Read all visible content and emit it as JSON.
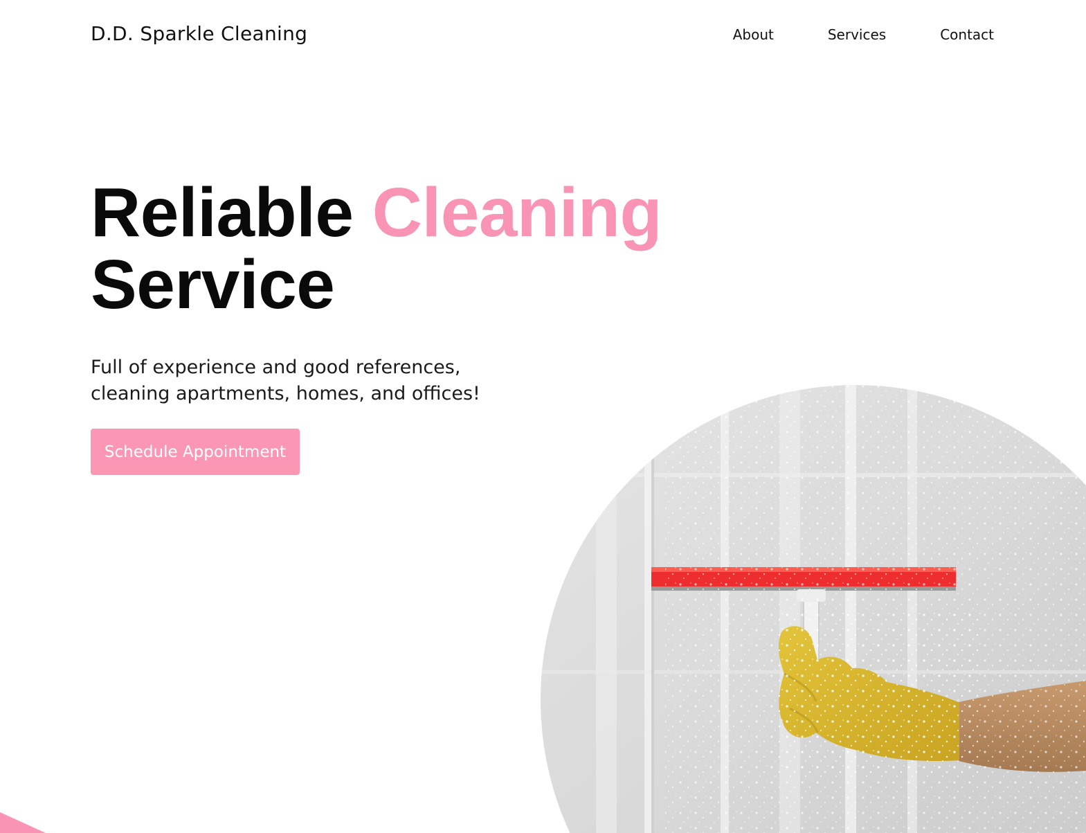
{
  "header": {
    "brand": "D.D. Sparkle Cleaning",
    "nav": {
      "about": "About",
      "services": "Services",
      "contact": "Contact"
    }
  },
  "hero": {
    "headline_part1": "Reliable",
    "headline_accent": "Cleaning",
    "headline_part2": "Service",
    "subtitle_line1": "Full of experience and good references,",
    "subtitle_line2": "cleaning apartments, homes, and offices!",
    "cta_label": "Schedule Appointment",
    "image_alt": "Gloved hand wiping a glass shower door with a red squeegee"
  },
  "colors": {
    "accent_pink": "#f994b4",
    "text": "#0a0a0a",
    "background": "#ffffff"
  }
}
